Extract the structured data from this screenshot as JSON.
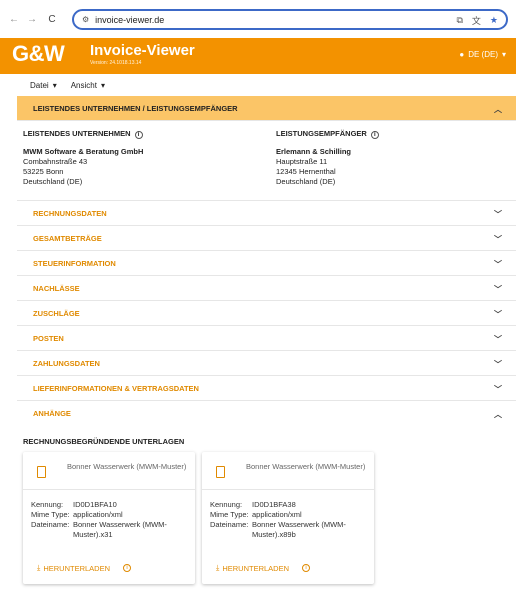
{
  "browser": {
    "url": "invoice-viewer.de",
    "back_icon": "←",
    "forward_icon": "→",
    "reload_icon": "C"
  },
  "app": {
    "logo": "G&W",
    "title": "Invoice-Viewer",
    "version": "Version: 24.1018.13.14",
    "language": "DE (DE)"
  },
  "menu": [
    {
      "label": "Datei"
    },
    {
      "label": "Ansicht"
    }
  ],
  "parties_section": {
    "title": "LEISTENDES UNTERNEHMEN / LEISTUNGSEMPFÄNGER",
    "left": {
      "title": "LEISTENDES UNTERNEHMEN",
      "name": "MWM Software & Beratung GmbH",
      "street": "Combahnstraße 43",
      "city": "53225 Bonn",
      "country": "Deutschland (DE)"
    },
    "right": {
      "title": "LEISTUNGSEMPFÄNGER",
      "name": "Erlemann & Schilling",
      "street": "Hauptstraße 11",
      "city": "12345 Hernenthal",
      "country": "Deutschland (DE)"
    }
  },
  "sections": [
    "RECHNUNGSDATEN",
    "GESAMTBETRÄGE",
    "STEUERINFORMATION",
    "NACHLÄSSE",
    "ZUSCHLÄGE",
    "POSTEN",
    "ZAHLUNGSDATEN",
    "LIEFERINFORMATIONEN & VERTRAGSDATEN",
    "ANHÄNGE"
  ],
  "attachments": {
    "subtitle": "RECHNUNGSBEGRÜNDENDE UNTERLAGEN",
    "label_kennung": "Kennung:",
    "label_mime": "Mime Type:",
    "label_file": "Dateiname:",
    "download_label": "HERUNTERLADEN",
    "items": [
      {
        "title": "Bonner Wasserwerk (MWM-Muster)",
        "kennung": "ID0D1BFA10",
        "mime": "application/xml",
        "filename": "Bonner Wasserwerk (MWM-Muster).x31"
      },
      {
        "title": "Bonner Wasserwerk (MWM-Muster)",
        "kennung": "ID0D1BFA38",
        "mime": "application/xml",
        "filename": "Bonner Wasserwerk (MWM-Muster).x89b"
      }
    ]
  },
  "colors": {
    "accent": "#f39200",
    "section_open_bg": "#fbc567",
    "url_border": "#3c69c7"
  }
}
